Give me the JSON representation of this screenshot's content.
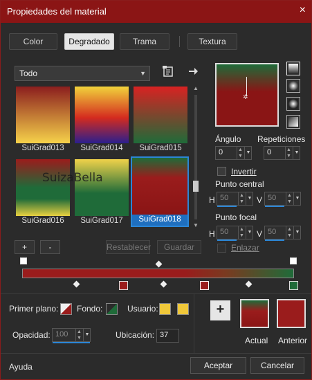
{
  "window": {
    "title": "Propiedades del material",
    "close_icon": "×"
  },
  "tabs": [
    {
      "label": "Color"
    },
    {
      "label": "Degradado"
    },
    {
      "label": "Trama"
    },
    {
      "label": "Textura"
    }
  ],
  "dropdown": {
    "value": "Todo"
  },
  "gradients": [
    {
      "name": "SuiGrad013",
      "colors": [
        "#8b1e1e",
        "#f6d24a"
      ]
    },
    {
      "name": "SuiGrad014",
      "colors": [
        "#f1d33b",
        "#d42b1f",
        "#2b1f8e"
      ]
    },
    {
      "name": "SuiGrad015",
      "colors": [
        "#d82222",
        "#1f6b39"
      ]
    },
    {
      "name": "SuiGrad016",
      "colors": [
        "#1f6b39",
        "#9a1c1c",
        "#e8d040"
      ]
    },
    {
      "name": "SuiGrad017",
      "colors": [
        "#f0d24a",
        "#1f6b39"
      ]
    },
    {
      "name": "SuiGrad018",
      "colors": [
        "#1f6b39",
        "#9a1c1c"
      ]
    }
  ],
  "watermark": "SuizaBella",
  "list_buttons": {
    "add": "+",
    "remove": "-",
    "reset": "Restablecer",
    "save": "Guardar"
  },
  "angle": {
    "label": "Ángulo",
    "value": "0"
  },
  "repeats": {
    "label": "Repeticiones",
    "value": "0"
  },
  "invert": {
    "label": "Invertir"
  },
  "center": {
    "label": "Punto central",
    "h_label": "H",
    "h": "50",
    "v_label": "V",
    "v": "50"
  },
  "focal": {
    "label": "Punto focal",
    "h_label": "H",
    "h": "50",
    "v_label": "V",
    "v": "50"
  },
  "link": {
    "label": "Enlazar"
  },
  "bottom": {
    "foreground_label": "Primer plano:",
    "background_label": "Fondo:",
    "user_label": "Usuario:",
    "opacity_label": "Opacidad:",
    "opacity_value": "100",
    "location_label": "Ubicación:",
    "location_value": "37",
    "current_label": "Actual",
    "previous_label": "Anterior"
  },
  "footer": {
    "help": "Ayuda",
    "ok": "Aceptar",
    "cancel": "Cancelar"
  },
  "colors": {
    "title_bg": "#8b1515",
    "accent": "#2b86d6",
    "red": "#9a1c1c",
    "green": "#1f6b39",
    "yellow": "#f0c83a"
  }
}
